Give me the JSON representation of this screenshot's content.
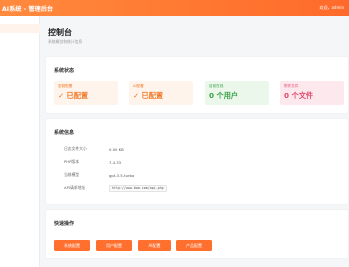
{
  "header": {
    "brand": "AI系统 - 管理后台",
    "user": "欢迎，admin"
  },
  "page": {
    "title": "控制台",
    "subtitle": "系统概览和统计信息"
  },
  "status": {
    "title": "系统状态",
    "cards": [
      {
        "label": "密钥配置",
        "value": "✓ 已配置",
        "bg": "#fff4eb",
        "color": "#f07a2a"
      },
      {
        "label": "AI配置",
        "value": "✓ 已配置",
        "bg": "#fff4eb",
        "color": "#f07a2a"
      },
      {
        "label": "目前在线",
        "value": "0 个用户",
        "bg": "#eaf7ea",
        "color": "#3aa04a"
      },
      {
        "label": "附件文件",
        "value": "0 个文件",
        "bg": "#fde8ee",
        "color": "#e04a6a"
      }
    ]
  },
  "info": {
    "title": "系统信息",
    "rows": [
      {
        "key": "日志文件大小",
        "value": "0.00 KB"
      },
      {
        "key": "PHP版本",
        "value": "7.4.33"
      },
      {
        "key": "当前模型",
        "value": "gpt-3.5-turbo"
      },
      {
        "key": "API请求地址",
        "value": "http://www.bwa.com/api.php"
      }
    ]
  },
  "actions": {
    "title": "快速操作",
    "buttons": [
      {
        "label": "系统配置"
      },
      {
        "label": "用户配置"
      },
      {
        "label": "AI配置"
      },
      {
        "label": "产品配置"
      }
    ]
  },
  "colors": {
    "accent": "#ff6f2e",
    "topbar": "#ff7a33"
  }
}
